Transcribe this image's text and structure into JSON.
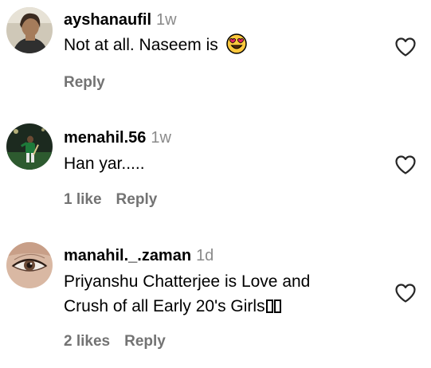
{
  "comments": [
    {
      "username": "ayshanaufil",
      "time": "1w",
      "text": "Not at all. Naseem is",
      "emoji": "heart-eyes-emoji",
      "likes": "",
      "reply": "Reply"
    },
    {
      "username": "menahil.56",
      "time": "1w",
      "text": "Han yar.....",
      "likes": "1 like",
      "reply": "Reply"
    },
    {
      "username": "manahil._.zaman",
      "time": "1d",
      "text_line1": "Priyanshu Chatterjee is Love and",
      "text_line2": "Crush of all Early 20's Girls",
      "likes": "2 likes",
      "reply": "Reply"
    }
  ],
  "colors": {
    "secondary_text": "#737373",
    "timestamp": "#8a8a8a",
    "heart_outline": "#262626",
    "emoji_yellow": "#ffc83d",
    "emoji_heart": "#e0245e"
  },
  "icons": {
    "like": "heart-outline-icon"
  }
}
